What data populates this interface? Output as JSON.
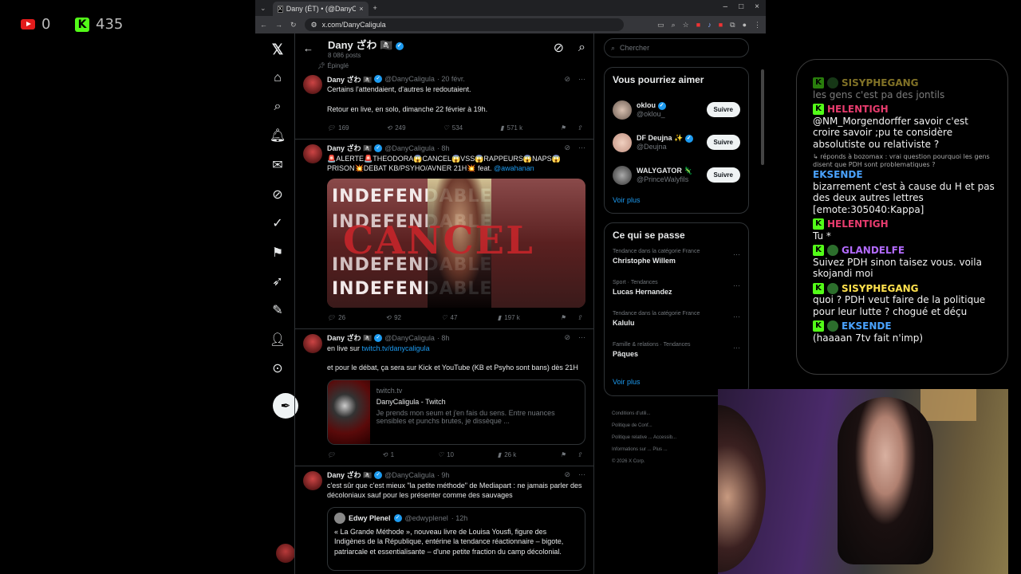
{
  "overlay": {
    "youtube_viewers": "0",
    "kick_viewers": "435"
  },
  "browser": {
    "tab_title": "Dany (ÉT) • (@DanyCaligula)",
    "url": "x.com/DanyCaligula"
  },
  "profile": {
    "name": "Dany ざわ 🏴‍☠️",
    "posts": "8 086 posts",
    "pinned_label": "Épinglé"
  },
  "tweets": [
    {
      "name": "Dany ざわ 🏴‍☠️",
      "handle": "@DanyCaligula",
      "time": "· 20 févr.",
      "text": "Certains l'attendaient, d'autres le redoutaient.\n\nRetour en live, en solo, dimanche 22 février à 19h.",
      "replies": "169",
      "reposts": "249",
      "likes": "534",
      "views": "571 k"
    },
    {
      "name": "Dany ざわ 🏴‍☠️",
      "handle": "@DanyCaligula",
      "time": "· 8h",
      "text": "🚨ALERTE🚨THEODORA😱CANCEL😱VSS😱RAPPEURS😱NAPS😱 PRISON💥DEBAT KB/PSYHO/AVNER 21H💥 feat. ",
      "mention": "@awahanan",
      "media_word": "INDEFENDABLE",
      "media_overlay": "CANCEL",
      "replies": "26",
      "reposts": "92",
      "likes": "47",
      "views": "197 k"
    },
    {
      "name": "Dany ざわ 🏴‍☠️",
      "handle": "@DanyCaligula",
      "time": "· 8h",
      "text_a": "en live sur ",
      "link": "twitch.tv/danycaligula",
      "text_b": "et pour le débat, ça sera sur Kick et YouTube (KB et Psyho sont bans) dès 21H",
      "card_domain": "twitch.tv",
      "card_title": "DanyCaligula - Twitch",
      "card_desc": "Je prends mon seum et j'en fais du sens. Entre nuances sensibles et punchs brutes, je dissèque ...",
      "replies": "",
      "reposts": "1",
      "likes": "10",
      "views": "26 k"
    },
    {
      "name": "Dany ざわ 🏴‍☠️",
      "handle": "@DanyCaligula",
      "time": "· 9h",
      "text": "c'est sûr que c'est mieux \"la petite méthode\" de Mediapart : ne jamais parler des décoloniaux sauf pour les présenter comme des sauvages",
      "quote_name": "Edwy Plenel",
      "quote_handle": "@edwyplenel",
      "quote_time": "· 12h",
      "quote_text": "« La Grande Méthode », nouveau livre de Louisa Yousfi, figure des Indigènes de la République, entérine la tendance réactionnaire – bigote, patriarcale et essentialisante – d'une petite fraction du camp décolonial."
    }
  ],
  "sidebar": {
    "search_placeholder": "Chercher",
    "follow_title": "Vous pourriez aimer",
    "follow": [
      {
        "name": "oklou",
        "handle": "@oklou_",
        "button": "Suivre"
      },
      {
        "name": "DF Deujna ✨",
        "handle": "@Deujna",
        "button": "Suivre"
      },
      {
        "name": "WALYGATOR 🦎",
        "handle": "@PrinceWalyfils",
        "button": "Suivre"
      }
    ],
    "more": "Voir plus",
    "trends_title": "Ce qui se passe",
    "trends": [
      {
        "context": "Tendance dans la catégorie France",
        "name": "Christophe Willem"
      },
      {
        "context": "Sport · Tendances",
        "name": "Lucas Hernandez"
      },
      {
        "context": "Tendance dans la catégorie France",
        "name": "Kalulu"
      },
      {
        "context": "Famille & relations · Tendances",
        "name": "Pâques"
      }
    ],
    "footer": [
      "Conditions d'utili...",
      "Politique de Conf...",
      "Politique relative ...   Accessib...",
      "Informations sur ...   Plus ...",
      "© 2026 X Corp."
    ]
  },
  "chat": [
    {
      "user": "SISYPHEGANG",
      "color": "#ffe14d",
      "text": "les gens c'est pa des jontils",
      "faded": true
    },
    {
      "user": "HELENTIGH",
      "color": "#e83c6e",
      "text": "@NM_Morgendorffer savoir c'est croire savoir ;pu te considère absolutiste ou relativiste ?"
    },
    {
      "reply": "↳ réponds à bozomax : vrai question pourquoi les gens disent que PDH sont problematiques ?",
      "user": "EKSENDE",
      "color": "#4aa3ff",
      "text": "bizarrement c'est à cause du H et pas des deux autres lettres [emote:305040:Kappa]"
    },
    {
      "user": "HELENTIGH",
      "color": "#e83c6e",
      "text": "Tu *"
    },
    {
      "user": "GLANDELFE",
      "color": "#b36bff",
      "text": "Suivez PDH sinon taisez vous. voila skojandi moi"
    },
    {
      "user": "SISYPHEGANG",
      "color": "#ffe14d",
      "text": "quoi ? PDH veut faire de la politique pour leur lutte ? chogué et déçu"
    },
    {
      "user": "EKSENDE",
      "color": "#4aa3ff",
      "text": "(haaaan 7tv fait n'imp)"
    }
  ]
}
